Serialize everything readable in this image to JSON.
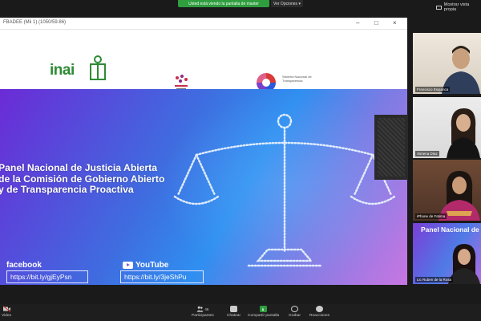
{
  "top": {
    "share_banner": "Usted está viendo la pantalla de master",
    "view_options": "Ver Opciones ▾",
    "view_mode": "Mostrar vista propia"
  },
  "shared_window": {
    "title": "FBADEE (Mii 1) (1050/59.86)",
    "controls": [
      "–",
      "□",
      "×"
    ],
    "logos": {
      "inai": "inai",
      "logo3_text": "Sistema Nacional de Transparencia"
    },
    "slide": {
      "headline": [
        "Panel Nacional de Justicia Abierta",
        "de la Comisión de Gobierno Abierto",
        "y de Transparencia Proactiva"
      ],
      "facebook_label": "facebook",
      "facebook_link": "https://bit.ly/gjEyPsn",
      "youtube_label": "YouTube",
      "youtube_link": "https://bit.ly/3jeShPu"
    }
  },
  "participants": [
    {
      "name": "Francisco Esquinca"
    },
    {
      "name": "Ximena Díaz"
    },
    {
      "name": "iPhone de Fatima"
    },
    {
      "name": "Lic Ruben de la Rosa",
      "slide_text": "Panel Nacional de Justi"
    }
  ],
  "toolbar": {
    "video": "Video",
    "participants": "Participantes",
    "participants_count": "46",
    "chat": "Chatear",
    "share": "Compartir pantalla",
    "record": "Grabar",
    "reactions": "Reacciones"
  },
  "colors": {
    "share_green": "#2e9e3e",
    "inai_green": "#2e8b35"
  }
}
